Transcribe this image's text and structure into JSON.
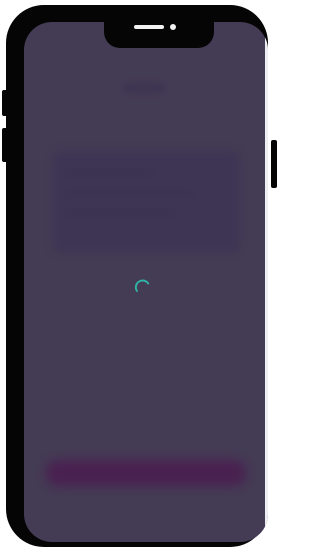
{
  "device": {
    "model_hint": "phone-frame"
  },
  "screen": {
    "state": "loading",
    "overlay_color": "#443b55",
    "spinner_color": "#2fb3a4",
    "cta_color": "#4a2050"
  }
}
